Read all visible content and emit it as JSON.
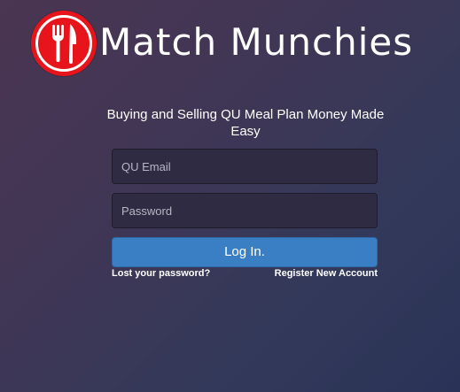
{
  "logo": {
    "icon": "fork-knife-icon",
    "colors": {
      "circle": "#e8141b",
      "glyph": "#ffffff"
    }
  },
  "brand": {
    "name": "Match Munchies"
  },
  "tagline": "Buying and Selling QU Meal Plan Money Made Easy",
  "form": {
    "email": {
      "placeholder": "QU Email",
      "value": ""
    },
    "password": {
      "placeholder": "Password",
      "value": ""
    },
    "submit_label": "Log In."
  },
  "links": {
    "lost_password": "Lost your password?",
    "register": "Register New Account"
  },
  "colors": {
    "background_start": "#4a3552",
    "background_end": "#2a3357",
    "field_bg": "#2f2b42",
    "button_bg": "#3a7fc4"
  }
}
